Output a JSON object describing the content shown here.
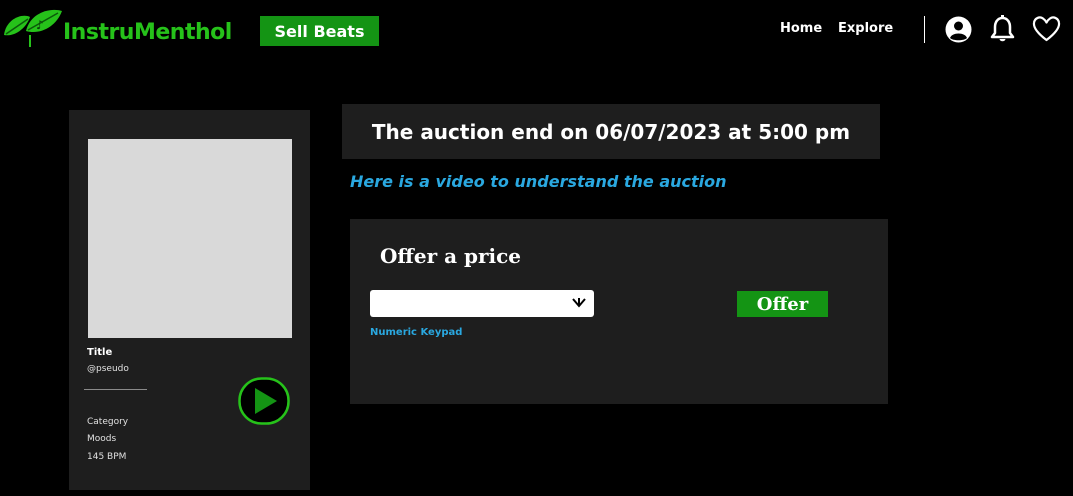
{
  "header": {
    "logo_text": "InstruMenthol",
    "sell_label": "Sell Beats",
    "nav": {
      "home": "Home",
      "explore": "Explore"
    },
    "icons": [
      "user-icon",
      "bell-icon",
      "heart-icon"
    ]
  },
  "beat": {
    "title": "Title",
    "artist": "@pseudo",
    "category": "Category",
    "mood": "Moods",
    "bpm": "145 BPM"
  },
  "auction": {
    "end_text": "The auction end on 06/07/2023 at 5:00 pm",
    "video_link": "Here is a video to understand the auction"
  },
  "offer": {
    "heading": "Offer a price",
    "select_value": "",
    "keypad_label": "Numeric Keypad",
    "button_label": "Offer"
  },
  "colors": {
    "brand_green": "#26c21a",
    "button_green": "#149414",
    "link_blue": "#2aa8e0",
    "panel_bg": "#1e1e1e",
    "page_bg": "#000000"
  }
}
